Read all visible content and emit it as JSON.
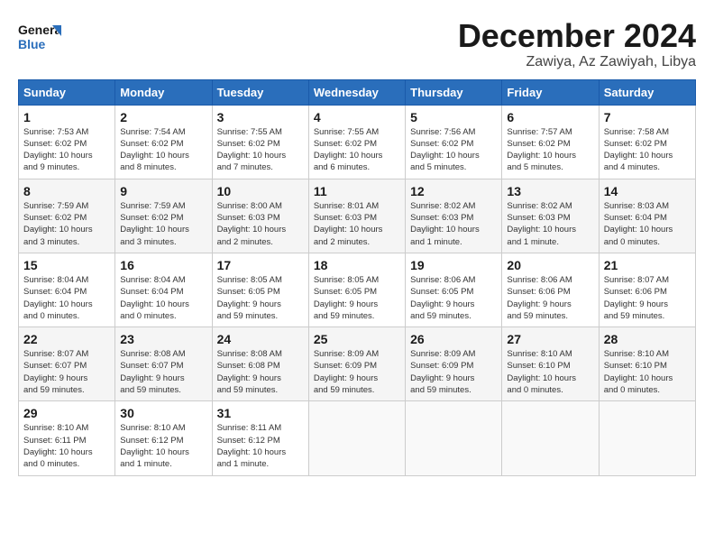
{
  "logo": {
    "text1": "General",
    "text2": "Blue"
  },
  "title": {
    "month": "December 2024",
    "location": "Zawiya, Az Zawiyah, Libya"
  },
  "headers": [
    "Sunday",
    "Monday",
    "Tuesday",
    "Wednesday",
    "Thursday",
    "Friday",
    "Saturday"
  ],
  "weeks": [
    [
      {
        "day": "1",
        "info": "Sunrise: 7:53 AM\nSunset: 6:02 PM\nDaylight: 10 hours\nand 9 minutes."
      },
      {
        "day": "2",
        "info": "Sunrise: 7:54 AM\nSunset: 6:02 PM\nDaylight: 10 hours\nand 8 minutes."
      },
      {
        "day": "3",
        "info": "Sunrise: 7:55 AM\nSunset: 6:02 PM\nDaylight: 10 hours\nand 7 minutes."
      },
      {
        "day": "4",
        "info": "Sunrise: 7:55 AM\nSunset: 6:02 PM\nDaylight: 10 hours\nand 6 minutes."
      },
      {
        "day": "5",
        "info": "Sunrise: 7:56 AM\nSunset: 6:02 PM\nDaylight: 10 hours\nand 5 minutes."
      },
      {
        "day": "6",
        "info": "Sunrise: 7:57 AM\nSunset: 6:02 PM\nDaylight: 10 hours\nand 5 minutes."
      },
      {
        "day": "7",
        "info": "Sunrise: 7:58 AM\nSunset: 6:02 PM\nDaylight: 10 hours\nand 4 minutes."
      }
    ],
    [
      {
        "day": "8",
        "info": "Sunrise: 7:59 AM\nSunset: 6:02 PM\nDaylight: 10 hours\nand 3 minutes."
      },
      {
        "day": "9",
        "info": "Sunrise: 7:59 AM\nSunset: 6:02 PM\nDaylight: 10 hours\nand 3 minutes."
      },
      {
        "day": "10",
        "info": "Sunrise: 8:00 AM\nSunset: 6:03 PM\nDaylight: 10 hours\nand 2 minutes."
      },
      {
        "day": "11",
        "info": "Sunrise: 8:01 AM\nSunset: 6:03 PM\nDaylight: 10 hours\nand 2 minutes."
      },
      {
        "day": "12",
        "info": "Sunrise: 8:02 AM\nSunset: 6:03 PM\nDaylight: 10 hours\nand 1 minute."
      },
      {
        "day": "13",
        "info": "Sunrise: 8:02 AM\nSunset: 6:03 PM\nDaylight: 10 hours\nand 1 minute."
      },
      {
        "day": "14",
        "info": "Sunrise: 8:03 AM\nSunset: 6:04 PM\nDaylight: 10 hours\nand 0 minutes."
      }
    ],
    [
      {
        "day": "15",
        "info": "Sunrise: 8:04 AM\nSunset: 6:04 PM\nDaylight: 10 hours\nand 0 minutes."
      },
      {
        "day": "16",
        "info": "Sunrise: 8:04 AM\nSunset: 6:04 PM\nDaylight: 10 hours\nand 0 minutes."
      },
      {
        "day": "17",
        "info": "Sunrise: 8:05 AM\nSunset: 6:05 PM\nDaylight: 9 hours\nand 59 minutes."
      },
      {
        "day": "18",
        "info": "Sunrise: 8:05 AM\nSunset: 6:05 PM\nDaylight: 9 hours\nand 59 minutes."
      },
      {
        "day": "19",
        "info": "Sunrise: 8:06 AM\nSunset: 6:05 PM\nDaylight: 9 hours\nand 59 minutes."
      },
      {
        "day": "20",
        "info": "Sunrise: 8:06 AM\nSunset: 6:06 PM\nDaylight: 9 hours\nand 59 minutes."
      },
      {
        "day": "21",
        "info": "Sunrise: 8:07 AM\nSunset: 6:06 PM\nDaylight: 9 hours\nand 59 minutes."
      }
    ],
    [
      {
        "day": "22",
        "info": "Sunrise: 8:07 AM\nSunset: 6:07 PM\nDaylight: 9 hours\nand 59 minutes."
      },
      {
        "day": "23",
        "info": "Sunrise: 8:08 AM\nSunset: 6:07 PM\nDaylight: 9 hours\nand 59 minutes."
      },
      {
        "day": "24",
        "info": "Sunrise: 8:08 AM\nSunset: 6:08 PM\nDaylight: 9 hours\nand 59 minutes."
      },
      {
        "day": "25",
        "info": "Sunrise: 8:09 AM\nSunset: 6:09 PM\nDaylight: 9 hours\nand 59 minutes."
      },
      {
        "day": "26",
        "info": "Sunrise: 8:09 AM\nSunset: 6:09 PM\nDaylight: 9 hours\nand 59 minutes."
      },
      {
        "day": "27",
        "info": "Sunrise: 8:10 AM\nSunset: 6:10 PM\nDaylight: 10 hours\nand 0 minutes."
      },
      {
        "day": "28",
        "info": "Sunrise: 8:10 AM\nSunset: 6:10 PM\nDaylight: 10 hours\nand 0 minutes."
      }
    ],
    [
      {
        "day": "29",
        "info": "Sunrise: 8:10 AM\nSunset: 6:11 PM\nDaylight: 10 hours\nand 0 minutes."
      },
      {
        "day": "30",
        "info": "Sunrise: 8:10 AM\nSunset: 6:12 PM\nDaylight: 10 hours\nand 1 minute."
      },
      {
        "day": "31",
        "info": "Sunrise: 8:11 AM\nSunset: 6:12 PM\nDaylight: 10 hours\nand 1 minute."
      },
      null,
      null,
      null,
      null
    ]
  ]
}
